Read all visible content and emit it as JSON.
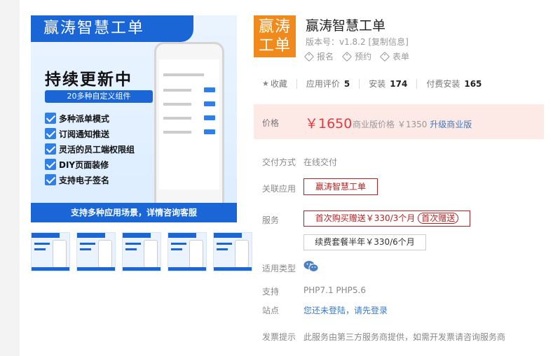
{
  "banner": {
    "title": "赢涛智慧工单",
    "headline": "持续更新中",
    "chip": "20多种自定义组件",
    "features": [
      "多种派单模式",
      "订阅通知推送",
      "灵活的员工端权限组",
      "DIY页面装修",
      "支持电子签名"
    ],
    "footer": "支持多种应用场景，详情咨询客服"
  },
  "thumbnails": [
    {
      "title": "赢涛智慧工单"
    },
    {
      "title": "赢涛智慧工单"
    },
    {
      "title": "赢涛智慧工单"
    },
    {
      "title": "赢涛智慧工单"
    },
    {
      "title": "赢涛智慧工单"
    }
  ],
  "logo": {
    "line1": "赢涛",
    "line2": "工单"
  },
  "product": {
    "title": "赢涛智慧工单",
    "version": "版本号：v1.8.2 [复制信息]",
    "tags": [
      "报名",
      "预约",
      "表单"
    ]
  },
  "stats": {
    "favorite_label": "收藏",
    "rating_label": "应用评价",
    "rating_value": "5",
    "install_label": "安装",
    "install_value": "174",
    "paid_label": "付费安装",
    "paid_value": "165"
  },
  "price": {
    "label": "价格",
    "amount": "￥1650",
    "commercial_label": "商业版价格 ￥1350",
    "upgrade": "升级商业版"
  },
  "details": {
    "payment_label": "交付方式",
    "payment_value": "在线交付",
    "related_label": "关联应用",
    "related_value": "赢涛智慧工单",
    "service_label": "服务",
    "service_first": "首次购买赠送￥330/3个月",
    "service_first_badge": "首次赠送",
    "service_renew": "续费套餐半年￥330/6个月",
    "type_label": "适用类型",
    "support_label": "支持",
    "support_value": "PHP7.1 PHP5.6",
    "site_label": "站点",
    "site_value": "您还未登陆，请先登录",
    "invoice_label": "发票提示",
    "invoice_value": "此服务由第三方服务商提供，如需开发票请咨询服务商"
  },
  "colors": {
    "brand_blue": "#1a66d6",
    "logo_orange": "#f08a1c",
    "price_red": "#e4393c",
    "price_bg": "#fde9e6",
    "outline_red": "#b32222"
  }
}
